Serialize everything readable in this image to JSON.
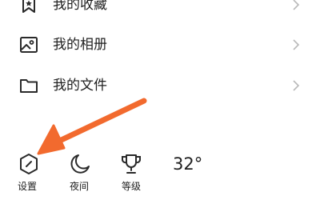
{
  "menu": [
    {
      "label": "我的收藏",
      "icon": "bookmark-icon"
    },
    {
      "label": "我的相册",
      "icon": "photo-album-icon"
    },
    {
      "label": "我的文件",
      "icon": "folder-icon"
    }
  ],
  "toolbar": {
    "settings_label": "设置",
    "night_label": "夜间",
    "level_label": "等级",
    "temperature": "32°"
  },
  "icons": {
    "settings": "hexagon-settings-icon",
    "night": "moon-icon",
    "level": "trophy-icon",
    "annotation": "orange-arrow"
  },
  "colors": {
    "arrow": "#f26a2e",
    "text": "#1f1f1f",
    "chevron": "#b9b9b9"
  }
}
